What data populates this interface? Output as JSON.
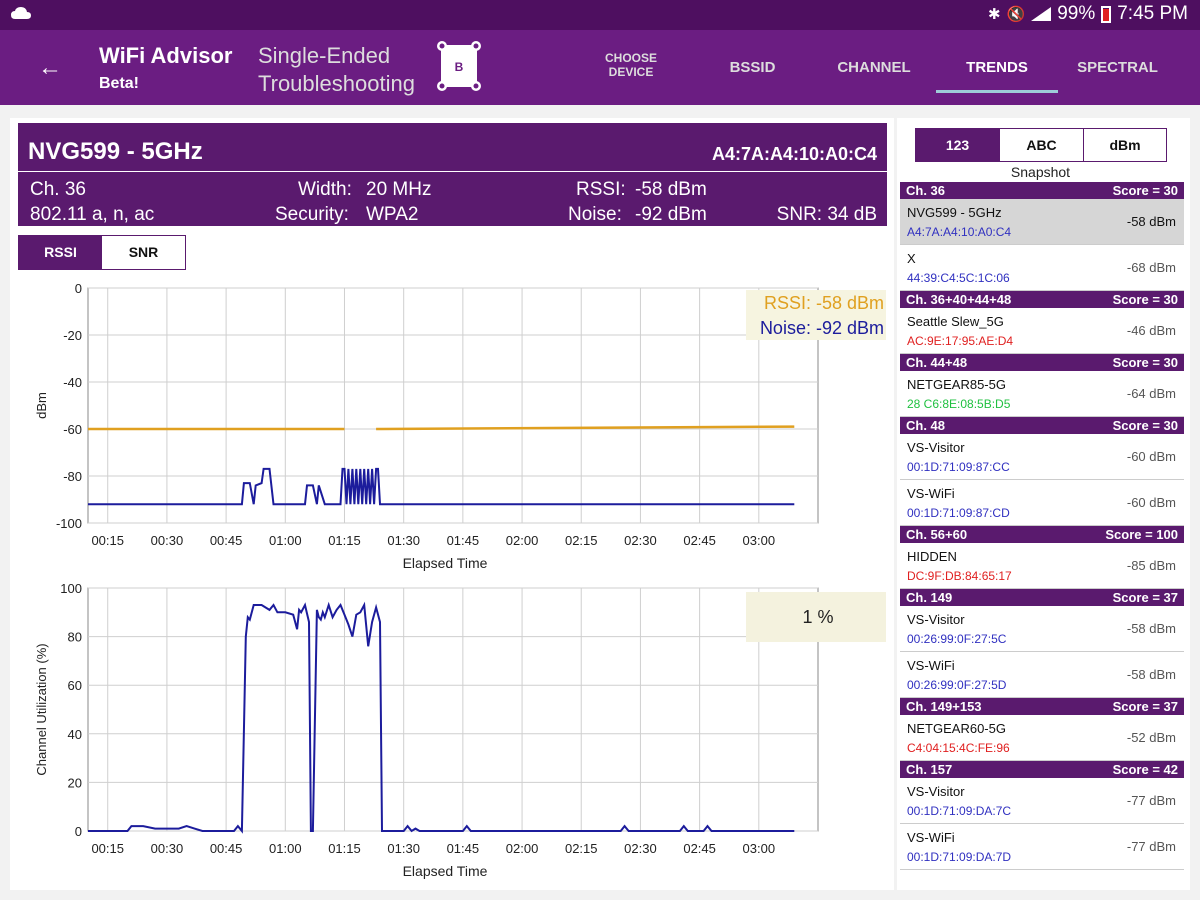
{
  "status_bar": {
    "battery": "99%",
    "time": "7:45 PM"
  },
  "app": {
    "title": "WiFi Advisor",
    "subtitle": "Beta!",
    "mode": "Single-Ended Troubleshooting",
    "device_badge": "B"
  },
  "tabs": [
    {
      "label": "CHOOSE DEVICE"
    },
    {
      "label": "BSSID"
    },
    {
      "label": "CHANNEL"
    },
    {
      "label": "TRENDS",
      "active": true
    },
    {
      "label": "SPECTRAL"
    }
  ],
  "device": {
    "name": "NVG599 - 5GHz",
    "mac": "A4:7A:A4:10:A0:C4",
    "channel": "Ch. 36",
    "standards": "802.11 a, n, ac",
    "width_label": "Width:",
    "width_value": "20 MHz",
    "security_label": "Security:",
    "security_value": "WPA2",
    "rssi_label": "RSSI:",
    "rssi_value": "-58 dBm",
    "noise_label": "Noise:",
    "noise_value": "-92 dBm",
    "snr": "SNR: 34 dB"
  },
  "toggle_metric": {
    "options": [
      "RSSI",
      "SNR"
    ],
    "selected": "RSSI"
  },
  "toggle_view": {
    "options": [
      "123",
      "ABC",
      "dBm"
    ],
    "selected": "123",
    "caption": "Snapshot"
  },
  "chart_data": [
    {
      "type": "line",
      "xlabel": "Elapsed Time",
      "ylabel": "dBm",
      "xlim": [
        10,
        195
      ],
      "ylim": [
        -100,
        0
      ],
      "yticks": [
        "0",
        "-20",
        "-40",
        "-60",
        "-80",
        "-100"
      ],
      "xticks": [
        "00:15",
        "00:30",
        "00:45",
        "01:00",
        "01:15",
        "01:30",
        "01:45",
        "02:00",
        "02:15",
        "02:30",
        "02:45",
        "03:00"
      ],
      "legend": [
        "RSSI: -58 dBm",
        "Noise: -92 dBm"
      ],
      "colors": {
        "rssi": "#e0a020",
        "noise": "#1c1c9c"
      },
      "series": [
        {
          "name": "RSSI",
          "segments": [
            {
              "x": [
                10,
                75
              ],
              "y": [
                -60,
                -60
              ]
            },
            {
              "x": [
                83,
                189
              ],
              "y": [
                -60,
                -59
              ]
            }
          ]
        },
        {
          "name": "Noise",
          "x": [
            10,
            49,
            49.5,
            51,
            52,
            52.5,
            54,
            54.5,
            56,
            57,
            58,
            65,
            65.5,
            67,
            68,
            68.5,
            70,
            74,
            74.5,
            75,
            75.5,
            76,
            76.5,
            77,
            77.5,
            78,
            78.5,
            79,
            79.5,
            80,
            80.5,
            81,
            81.5,
            82,
            82.5,
            83,
            83.5,
            84,
            189
          ],
          "y": [
            -92,
            -92,
            -83,
            -83,
            -92,
            -84,
            -83,
            -77,
            -77,
            -92,
            -92,
            -92,
            -84,
            -84,
            -92,
            -84,
            -92,
            -92,
            -77,
            -77,
            -92,
            -77,
            -92,
            -77,
            -92,
            -77,
            -92,
            -77,
            -92,
            -77,
            -92,
            -77,
            -92,
            -77,
            -92,
            -77,
            -77,
            -92,
            -92
          ]
        }
      ]
    },
    {
      "type": "line",
      "xlabel": "Elapsed Time",
      "ylabel": "Channel Utilization (%)",
      "xlim": [
        10,
        195
      ],
      "ylim": [
        0,
        100
      ],
      "yticks": [
        "100",
        "80",
        "60",
        "40",
        "20",
        "0"
      ],
      "xticks": [
        "00:15",
        "00:30",
        "00:45",
        "01:00",
        "01:15",
        "01:30",
        "01:45",
        "02:00",
        "02:15",
        "02:30",
        "02:45",
        "03:00"
      ],
      "readout": "1 %",
      "color": "#1c1c9c",
      "series": [
        {
          "name": "Utilization",
          "x": [
            10,
            20,
            21,
            24,
            27,
            33,
            35,
            37,
            39,
            47,
            48,
            49,
            50,
            50.5,
            51,
            52,
            54,
            56,
            57,
            58,
            60,
            62,
            63,
            63.5,
            64,
            65,
            66,
            66.5,
            67,
            68,
            68.5,
            69,
            69.5,
            70,
            71,
            72,
            73,
            74,
            75,
            76,
            77,
            78,
            79,
            80,
            81,
            82,
            83,
            84,
            84.5,
            90,
            91,
            92,
            93,
            94,
            105,
            106,
            107,
            145,
            146,
            147,
            160,
            161,
            162,
            166,
            167,
            168,
            189
          ],
          "y": [
            0,
            0,
            2,
            2,
            1,
            1,
            2,
            1,
            0,
            0,
            2,
            0,
            80,
            88,
            87,
            93,
            93,
            91,
            93,
            90,
            90,
            89,
            83,
            91,
            90,
            93,
            86,
            0,
            0,
            91,
            88,
            87,
            90,
            88,
            93,
            88,
            91,
            93,
            89,
            85,
            80,
            89,
            90,
            93,
            76,
            86,
            92,
            86,
            0,
            0,
            2,
            0,
            1,
            0,
            0,
            2,
            0,
            0,
            2,
            0,
            0,
            2,
            0,
            0,
            2,
            0,
            0
          ]
        }
      ]
    }
  ],
  "bssid_list": [
    {
      "header": "Ch. 36",
      "score": "Score = 30",
      "items": [
        {
          "ssid": "NVG599 - 5GHz",
          "bssid": "A4:7A:A4:10:A0:C4",
          "rssi": "-58 dBm",
          "color": "#3030c0",
          "selected": true
        },
        {
          "ssid": "X",
          "bssid": "44:39:C4:5C:1C:06",
          "rssi": "-68 dBm",
          "color": "#3030c0"
        }
      ]
    },
    {
      "header": "Ch. 36+40+44+48",
      "score": "Score = 30",
      "items": [
        {
          "ssid": "Seattle Slew_5G",
          "bssid": "AC:9E:17:95:AE:D4",
          "rssi": "-46 dBm",
          "color": "#e02020"
        }
      ]
    },
    {
      "header": "Ch. 44+48",
      "score": "Score = 30",
      "items": [
        {
          "ssid": "NETGEAR85-5G",
          "bssid": "28 C6:8E:08:5B:D5",
          "rssi": "-64 dBm",
          "color": "#20c040"
        }
      ]
    },
    {
      "header": "Ch. 48",
      "score": "Score = 30",
      "items": [
        {
          "ssid": "VS-Visitor",
          "bssid": "00:1D:71:09:87:CC",
          "rssi": "-60 dBm",
          "color": "#3030c0"
        },
        {
          "ssid": "VS-WiFi",
          "bssid": "00:1D:71:09:87:CD",
          "rssi": "-60 dBm",
          "color": "#3030c0"
        }
      ]
    },
    {
      "header": "Ch. 56+60",
      "score": "Score = 100",
      "items": [
        {
          "ssid": "HIDDEN",
          "bssid": "DC:9F:DB:84:65:17",
          "rssi": "-85 dBm",
          "color": "#e02020"
        }
      ]
    },
    {
      "header": "Ch. 149",
      "score": "Score = 37",
      "items": [
        {
          "ssid": "VS-Visitor",
          "bssid": "00:26:99:0F:27:5C",
          "rssi": "-58 dBm",
          "color": "#3030c0"
        },
        {
          "ssid": "VS-WiFi",
          "bssid": "00:26:99:0F:27:5D",
          "rssi": "-58 dBm",
          "color": "#3030c0"
        }
      ]
    },
    {
      "header": "Ch. 149+153",
      "score": "Score = 37",
      "items": [
        {
          "ssid": "NETGEAR60-5G",
          "bssid": "C4:04:15:4C:FE:96",
          "rssi": "-52 dBm",
          "color": "#e02020"
        }
      ]
    },
    {
      "header": "Ch. 157",
      "score": "Score = 42",
      "items": [
        {
          "ssid": "VS-Visitor",
          "bssid": "00:1D:71:09:DA:7C",
          "rssi": "-77 dBm",
          "color": "#3030c0"
        },
        {
          "ssid": "VS-WiFi",
          "bssid": "00:1D:71:09:DA:7D",
          "rssi": "-77 dBm",
          "color": "#3030c0"
        }
      ]
    }
  ]
}
